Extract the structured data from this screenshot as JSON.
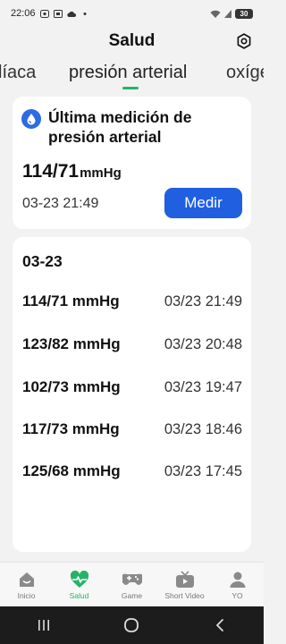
{
  "status_bar": {
    "time": "22:06",
    "battery": "30"
  },
  "header": {
    "title": "Salud"
  },
  "tabs": [
    {
      "label": "líaca"
    },
    {
      "label": "presión arterial",
      "active": true
    },
    {
      "label": "oxíge"
    }
  ],
  "latest": {
    "title": "Última medición de presión arterial",
    "value": "114/71",
    "unit": "mmHg",
    "time": "03-23 21:49",
    "button_label": "Medir"
  },
  "history": {
    "date": "03-23",
    "rows": [
      {
        "value": "114/71 mmHg",
        "time": "03/23 21:49"
      },
      {
        "value": "123/82 mmHg",
        "time": "03/23 20:48"
      },
      {
        "value": "102/73 mmHg",
        "time": "03/23 19:47"
      },
      {
        "value": "117/73 mmHg",
        "time": "03/23 18:46"
      },
      {
        "value": "125/68 mmHg",
        "time": "03/23 17:45"
      }
    ]
  },
  "bottom_nav": [
    {
      "label": "Inicio",
      "icon": "home-icon"
    },
    {
      "label": "Salud",
      "icon": "heart-pulse-icon",
      "active": true
    },
    {
      "label": "Game",
      "icon": "gamepad-icon"
    },
    {
      "label": "Short Video",
      "icon": "tv-play-icon"
    },
    {
      "label": "YO",
      "icon": "person-icon"
    }
  ],
  "colors": {
    "accent_green": "#27b26a",
    "button_blue": "#1f5fe0",
    "drop_blue": "#2d6be4"
  }
}
